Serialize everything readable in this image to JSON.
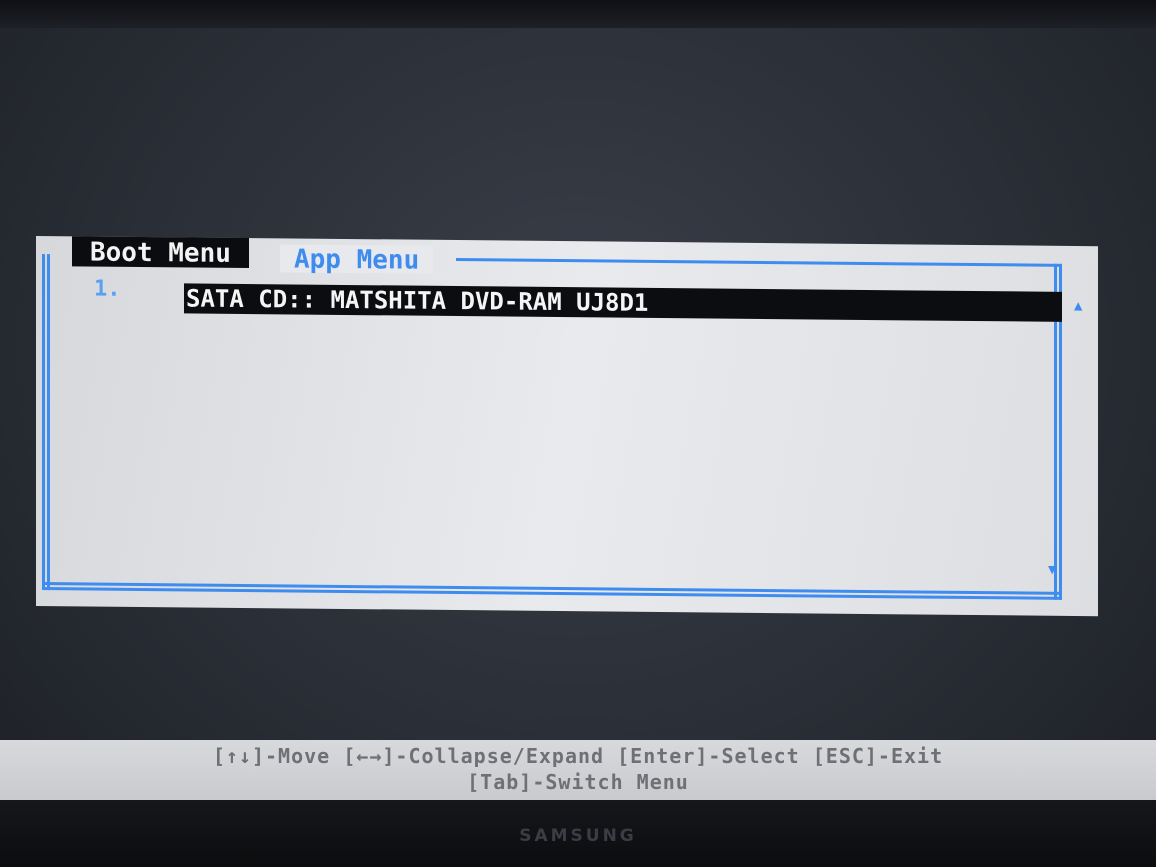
{
  "tabs": {
    "boot_menu": "Boot Menu",
    "app_menu": "App Menu"
  },
  "boot_items": [
    {
      "number": "1.",
      "label": "SATA CD:: MATSHITA DVD-RAM UJ8D1"
    }
  ],
  "footer": {
    "line1": "[↑↓]-Move [←→]-Collapse/Expand [Enter]-Select [ESC]-Exit",
    "line2": "[Tab]-Switch Menu"
  },
  "monitor_brand": "SAMSUNG",
  "colors": {
    "accent": "#3f8cf0",
    "dialog_bg": "#e3e5e8",
    "selection_bg": "#0c0d11",
    "selection_text": "#f5f5f5"
  },
  "icons": {
    "scroll_up": "triangle-up-icon",
    "scroll_down": "triangle-down-icon"
  }
}
